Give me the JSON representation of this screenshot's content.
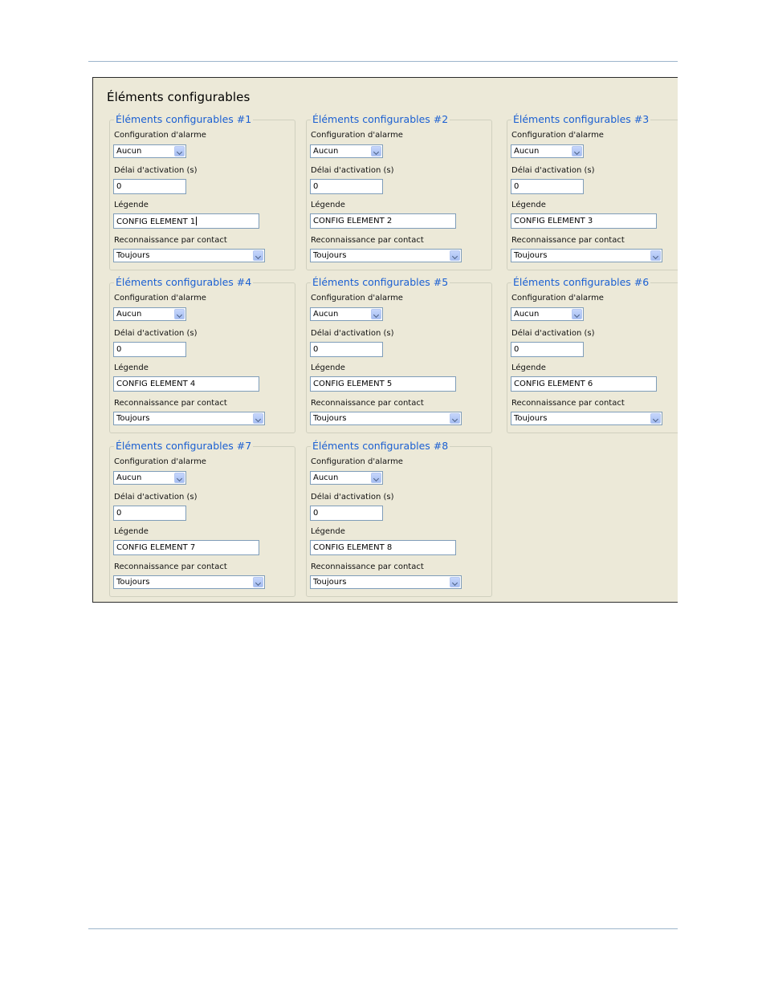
{
  "panel": {
    "title": "Éléments configurables"
  },
  "labels": {
    "alarm_config": "Configuration d'alarme",
    "delay": "Délai d'activation (s)",
    "legend": "Légende",
    "contact": "Reconnaissance par contact"
  },
  "groups": [
    {
      "title": "Éléments configurables #1",
      "alarm": "Aucun",
      "delay": "0",
      "legend_text": "CONFIG ELEMENT 1",
      "contact": "Toujours"
    },
    {
      "title": "Éléments configurables #2",
      "alarm": "Aucun",
      "delay": "0",
      "legend_text": "CONFIG ELEMENT 2",
      "contact": "Toujours"
    },
    {
      "title": "Éléments configurables #3",
      "alarm": "Aucun",
      "delay": "0",
      "legend_text": "CONFIG ELEMENT 3",
      "contact": "Toujours"
    },
    {
      "title": "Éléments configurables #4",
      "alarm": "Aucun",
      "delay": "0",
      "legend_text": "CONFIG ELEMENT 4",
      "contact": "Toujours"
    },
    {
      "title": "Éléments configurables #5",
      "alarm": "Aucun",
      "delay": "0",
      "legend_text": "CONFIG ELEMENT 5",
      "contact": "Toujours"
    },
    {
      "title": "Éléments configurables #6",
      "alarm": "Aucun",
      "delay": "0",
      "legend_text": "CONFIG ELEMENT 6",
      "contact": "Toujours"
    },
    {
      "title": "Éléments configurables #7",
      "alarm": "Aucun",
      "delay": "0",
      "legend_text": "CONFIG ELEMENT 7",
      "contact": "Toujours"
    },
    {
      "title": "Éléments configurables #8",
      "alarm": "Aucun",
      "delay": "0",
      "legend_text": "CONFIG ELEMENT 8",
      "contact": "Toujours"
    }
  ],
  "colors": {
    "panel_bg": "#ece9d8",
    "legend_text": "#1a5fd2",
    "input_border": "#7f9db9"
  },
  "icons": {
    "dropdown": "chevron-down-icon"
  }
}
